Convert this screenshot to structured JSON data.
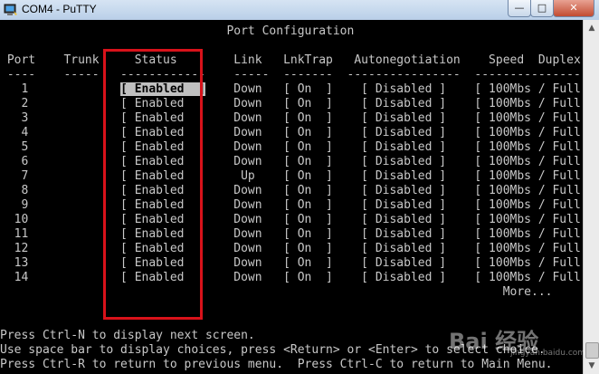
{
  "window": {
    "title": "COM4 - PuTTY",
    "buttons": {
      "minimize": "—",
      "maximize": "□",
      "close": "✕"
    },
    "colors": {
      "terminal_bg": "#000000",
      "terminal_fg": "#c8c8c8",
      "highlight_bg": "#c0c0c0",
      "annotation": "#d8121a"
    }
  },
  "terminal": {
    "lines": [
      "                                Port Configuration",
      "",
      " Port    Trunk     Status        Link   LnkTrap   Autonegotiation    Speed  Duplex",
      " ----    -----   ------------    -----  -------  ----------------  ------------------",
      "   1             [ Enabled  ]    Down   [ On  ]    [ Disabled ]    [ 100Mbs / Full ]",
      "   2             [ Enabled  ]    Down   [ On  ]    [ Disabled ]    [ 100Mbs / Full ]",
      "   3             [ Enabled  ]    Down   [ On  ]    [ Disabled ]    [ 100Mbs / Full ]",
      "   4             [ Enabled  ]    Down   [ On  ]    [ Disabled ]    [ 100Mbs / Full ]",
      "   5             [ Enabled  ]    Down   [ On  ]    [ Disabled ]    [ 100Mbs / Full ]",
      "   6             [ Enabled  ]    Down   [ On  ]    [ Disabled ]    [ 100Mbs / Full ]",
      "   7             [ Enabled  ]     Up    [ On  ]    [ Disabled ]    [ 100Mbs / Full ]",
      "   8             [ Enabled  ]    Down   [ On  ]    [ Disabled ]    [ 100Mbs / Full ]",
      "   9             [ Enabled  ]    Down   [ On  ]    [ Disabled ]    [ 100Mbs / Full ]",
      "  10             [ Enabled  ]    Down   [ On  ]    [ Disabled ]    [ 100Mbs / Full ]",
      "  11             [ Enabled  ]    Down   [ On  ]    [ Disabled ]    [ 100Mbs / Full ]",
      "  12             [ Enabled  ]    Down   [ On  ]    [ Disabled ]    [ 100Mbs / Full ]",
      "  13             [ Enabled  ]    Down   [ On  ]    [ Disabled ]    [ 100Mbs / Full ]",
      "  14             [ Enabled  ]    Down   [ On  ]    [ Disabled ]    [ 100Mbs / Full ]",
      "                                                                       More...",
      "",
      "",
      "Press Ctrl-N to display next screen.",
      "Use space bar to display choices, press <Return> or <Enter> to select choice.",
      "Press Ctrl-R to return to previous menu.  Press Ctrl-C to return to Main Menu."
    ],
    "selected_field": "[ Enabled  ]"
  },
  "watermark": {
    "text": "Bai  经验",
    "sub": "jingyan.baidu.com"
  }
}
